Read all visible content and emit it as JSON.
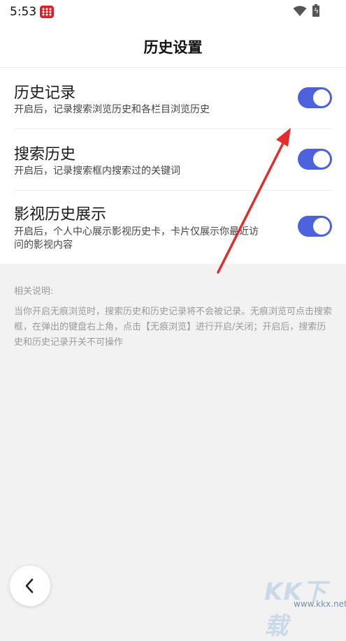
{
  "status_bar": {
    "time": "5:53",
    "icons": [
      "app-badge-icon",
      "wifi-icon",
      "battery-charging-icon"
    ]
  },
  "header": {
    "title": "历史设置"
  },
  "settings": [
    {
      "title": "历史记录",
      "description": "开启后，记录搜索浏览历史和各栏目浏览历史",
      "enabled": true
    },
    {
      "title": "搜索历史",
      "description": "开启后，记录搜索框内搜索过的关键词",
      "enabled": true
    },
    {
      "title": "影视历史展示",
      "description": "开启后，个人中心展示影视历史卡，卡片仅展示你最近访问的影视内容",
      "enabled": true
    }
  ],
  "notes": {
    "heading": "相关说明:",
    "body": "当你开启无痕浏览时，搜索历史和历史记录将不会被记录。无痕浏览可点击搜索框，在弹出的键盘右上角，点击【无痕浏览】进行开启/关闭；开启后，搜索历史和历史记录开关不可操作"
  },
  "back": {
    "icon": "chevron-left-icon"
  },
  "watermark": {
    "text": "KK下载",
    "url": "www.kkx.net"
  },
  "colors": {
    "accent": "#4b61de",
    "annotation": "#e52b2b",
    "background": "#f2f2f2"
  }
}
